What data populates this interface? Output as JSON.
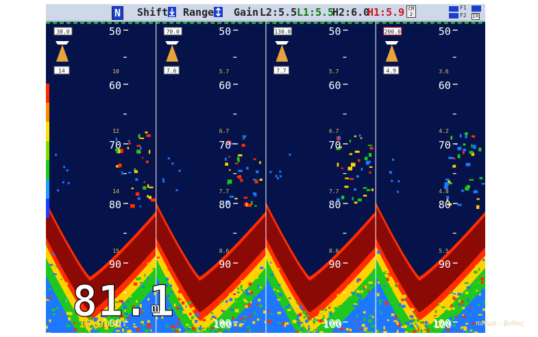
{
  "status": {
    "orientation": "N",
    "shift_label": "Shift:",
    "range_label": "Range:",
    "gain_label": "Gain",
    "l2": "L2:5.5",
    "l1": "L1:5.5",
    "h2": "H2:6.0",
    "h1": "H1:5.9",
    "cm_top": "CM",
    "cm_bottom": "2",
    "f1": "F1",
    "f2": "F2",
    "ir": "IR"
  },
  "panels": [
    {
      "freq": "38.0",
      "gain": "14",
      "scale": [
        "10",
        "12",
        "14",
        "15"
      ]
    },
    {
      "freq": "70.0",
      "gain": "7.6",
      "scale": [
        "5.7",
        "6.7",
        "7.7",
        "8.6"
      ]
    },
    {
      "freq": "130.0",
      "gain": "7.7",
      "scale": [
        "5.7",
        "6.7",
        "7.7",
        "8.6"
      ]
    },
    {
      "freq": "200.0",
      "gain": "4.9",
      "scale": [
        "3.6",
        "4.2",
        "4.8",
        "5.5"
      ]
    }
  ],
  "depth_ticks": [
    "50",
    "60",
    "70",
    "80",
    "90",
    "100"
  ],
  "readouts": {
    "depth_value": "81.1",
    "depth_unit": "m",
    "water_temp": "15.90°C"
  },
  "watermark": "πυθμα - βυθος",
  "colors": {
    "water": "#06134a",
    "bottom": "#8c0a05",
    "strong": "#ff2d00",
    "medium": "#ffd200",
    "weak": "#1ec81e",
    "weakest": "#1e78ff"
  }
}
